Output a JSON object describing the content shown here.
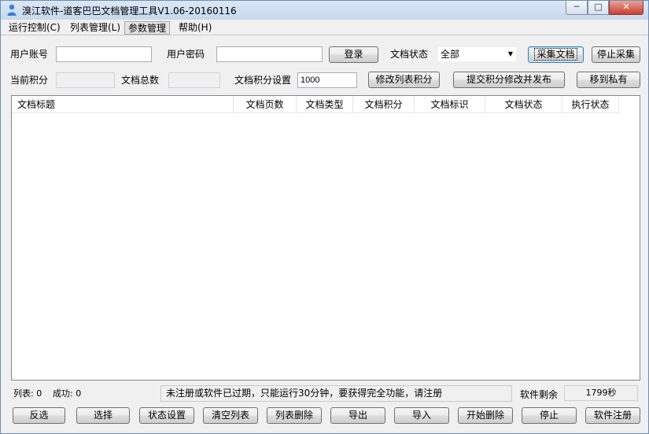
{
  "window": {
    "title": "溴江软件-道客巴巴文档管理工具V1.06-20160116",
    "min_label": "─",
    "max_label": "□",
    "close_label": "✕"
  },
  "menu": {
    "items": [
      "运行控制(C)",
      "列表管理(L)",
      "参数管理",
      "帮助(H)"
    ]
  },
  "form": {
    "username_label": "用户账号",
    "username_value": "",
    "password_label": "用户密码",
    "password_value": "",
    "login_button": "登录",
    "doc_status_label": "文档状态",
    "doc_status_value": "全部",
    "collect_button": "采集文档",
    "stop_collect_button": "停止采集",
    "current_points_label": "当前积分",
    "current_points_value": "",
    "doc_total_label": "文档总数",
    "doc_total_value": "",
    "points_setting_label": "文档积分设置",
    "points_setting_value": "1000",
    "modify_points_button": "修改列表积分",
    "submit_publish_button": "提交积分修改并发布",
    "move_private_button": "移到私有"
  },
  "table": {
    "columns": [
      "文档标题",
      "文档页数",
      "文档类型",
      "文档积分",
      "文档标识",
      "文档状态",
      "执行状态"
    ],
    "rows": []
  },
  "status": {
    "list_label": "列表: 0",
    "success_label": "成功: 0",
    "message": "未注册或软件已过期，只能运行30分钟，要获得完全功能，请注册",
    "remaining_label": "软件剩余",
    "remaining_value": "1799秒"
  },
  "bottom_buttons": [
    "反选",
    "选择",
    "状态设置",
    "清空列表",
    "列表删除",
    "导出",
    "导入",
    "开始删除",
    "停止",
    "软件注册"
  ],
  "colors": {
    "title_bar": "#c7d8ee",
    "window_bg": "#f0f0f0",
    "close_button": "#c6402f"
  }
}
